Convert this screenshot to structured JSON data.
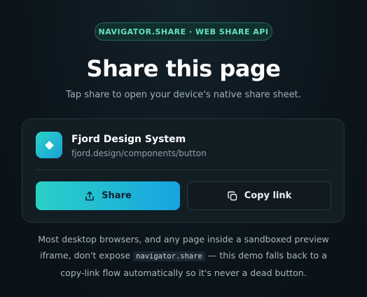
{
  "badge": {
    "label": "NAVIGATOR.SHARE · WEB SHARE API"
  },
  "header": {
    "title": "Share this page",
    "subtitle": "Tap share to open your device's native share sheet."
  },
  "share_card": {
    "app_icon": "diamond-logo-icon",
    "app_name": "Fjord Design System",
    "app_url": "fjord.design/components/button",
    "share_button": {
      "label": "Share",
      "icon": "share-upload-icon"
    },
    "copy_button": {
      "label": "Copy link",
      "icon": "copy-icon"
    }
  },
  "footnote": {
    "text_before": "Most desktop browsers, and any page inside a sandboxed preview iframe, don't expose ",
    "code": "navigator.share",
    "text_after": " — this demo falls back to a copy-link flow automatically so it's never a dead button."
  },
  "colors": {
    "background": "#0c151c",
    "accent_teal": "#2bd0c6",
    "accent_blue": "#17a4e2",
    "badge_text": "#67e0c8",
    "card_bg": "#131d24"
  }
}
